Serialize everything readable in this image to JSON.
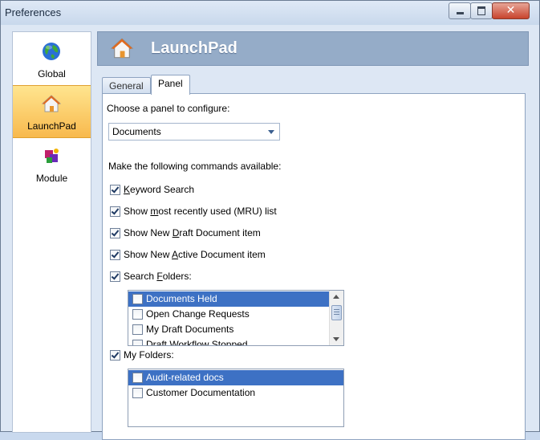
{
  "window": {
    "title": "Preferences",
    "close_glyph": "✕"
  },
  "nav": {
    "items": [
      {
        "label": "Global",
        "icon": "globe-icon"
      },
      {
        "label": "LaunchPad",
        "icon": "home-icon"
      },
      {
        "label": "Module",
        "icon": "module-icon"
      }
    ],
    "selected": "LaunchPad"
  },
  "header": {
    "title": "LaunchPad",
    "icon": "home-icon"
  },
  "tabs": [
    {
      "label": "General"
    },
    {
      "label": "Panel"
    }
  ],
  "active_tab": "Panel",
  "panel": {
    "choose_label": "Choose a panel to configure:",
    "dropdown_value": "Documents",
    "commands_label": "Make the following commands available:",
    "commands": [
      {
        "pre": "",
        "u": "K",
        "post": "eyword Search",
        "checked": true
      },
      {
        "pre": "Show ",
        "u": "m",
        "post": "ost recently used (MRU) list",
        "checked": true
      },
      {
        "pre": "Show New ",
        "u": "D",
        "post": "raft Document item",
        "checked": true
      },
      {
        "pre": "Show New ",
        "u": "A",
        "post": "ctive Document item",
        "checked": true
      },
      {
        "pre": "Search ",
        "u": "F",
        "post": "olders:",
        "checked": true
      }
    ],
    "search_folders": [
      {
        "label": "Documents Held",
        "selected": true,
        "checked": false
      },
      {
        "label": "Open Change Requests",
        "selected": false,
        "checked": false
      },
      {
        "label": "My Draft Documents",
        "selected": false,
        "checked": false
      },
      {
        "label": "Draft Workflow Stopped",
        "selected": false,
        "checked": false
      }
    ],
    "my_folders_label": "My Folders:",
    "my_folders_checked": true,
    "my_folders": [
      {
        "label": "Audit-related docs",
        "selected": true,
        "checked": false
      },
      {
        "label": "Customer Documentation",
        "selected": false,
        "checked": false
      }
    ]
  },
  "colors": {
    "selection": "#3d71c4",
    "nav_selected": "#f8b94d",
    "header": "#95acc8"
  }
}
